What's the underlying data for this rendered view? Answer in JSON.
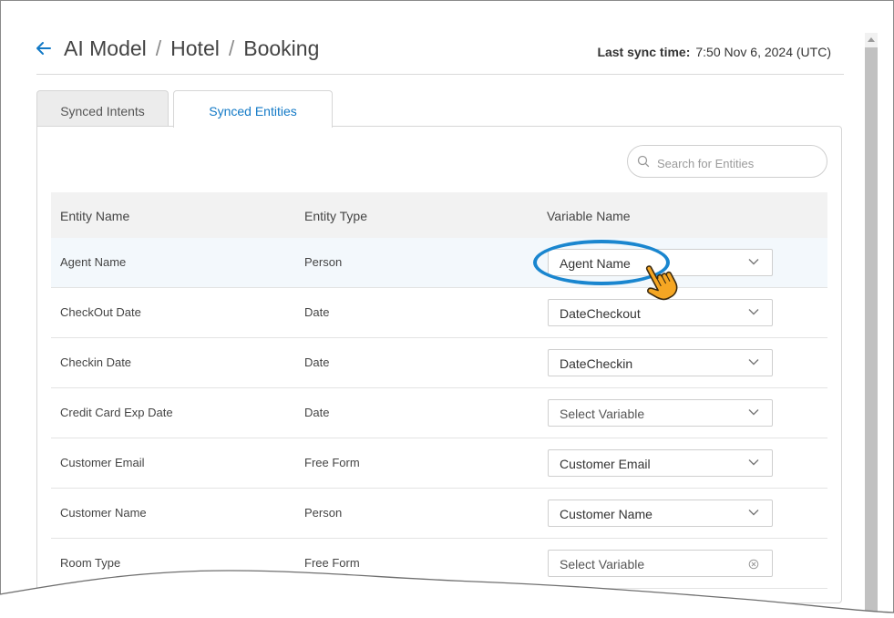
{
  "header": {
    "breadcrumb": [
      "AI Model",
      "Hotel",
      "Booking"
    ],
    "sync_label": "Last sync time:",
    "sync_value": "7:50 Nov 6, 2024 (UTC)"
  },
  "tabs": [
    {
      "label": "Synced Intents",
      "active": false
    },
    {
      "label": "Synced Entities",
      "active": true
    }
  ],
  "search": {
    "placeholder": "Search for Entities",
    "value": ""
  },
  "table": {
    "columns": [
      "Entity Name",
      "Entity Type",
      "Variable Name"
    ],
    "rows": [
      {
        "name": "Agent Name",
        "type": "Person",
        "variable": "Agent Name",
        "placeholder": false,
        "control": "chevron"
      },
      {
        "name": "CheckOut Date",
        "type": "Date",
        "variable": "DateCheckout",
        "placeholder": false,
        "control": "chevron"
      },
      {
        "name": "Checkin Date",
        "type": "Date",
        "variable": "DateCheckin",
        "placeholder": false,
        "control": "chevron"
      },
      {
        "name": "Credit Card Exp Date",
        "type": "Date",
        "variable": "Select Variable",
        "placeholder": true,
        "control": "chevron"
      },
      {
        "name": "Customer Email",
        "type": "Free Form",
        "variable": "Customer Email",
        "placeholder": false,
        "control": "chevron"
      },
      {
        "name": "Customer Name",
        "type": "Person",
        "variable": "Customer Name",
        "placeholder": false,
        "control": "chevron"
      },
      {
        "name": "Room Type",
        "type": "Free Form",
        "variable": "Select Variable",
        "placeholder": true,
        "control": "clear"
      }
    ]
  },
  "colors": {
    "accent": "#1279c6",
    "highlight": "#1a86cf",
    "cursor": "#f5a623"
  },
  "icons": {
    "back": "arrow-left-icon",
    "search": "search-icon",
    "dropdown": "chevron-down-icon",
    "clear": "clear-circle-icon",
    "cursor": "pointing-hand-cursor-icon"
  }
}
